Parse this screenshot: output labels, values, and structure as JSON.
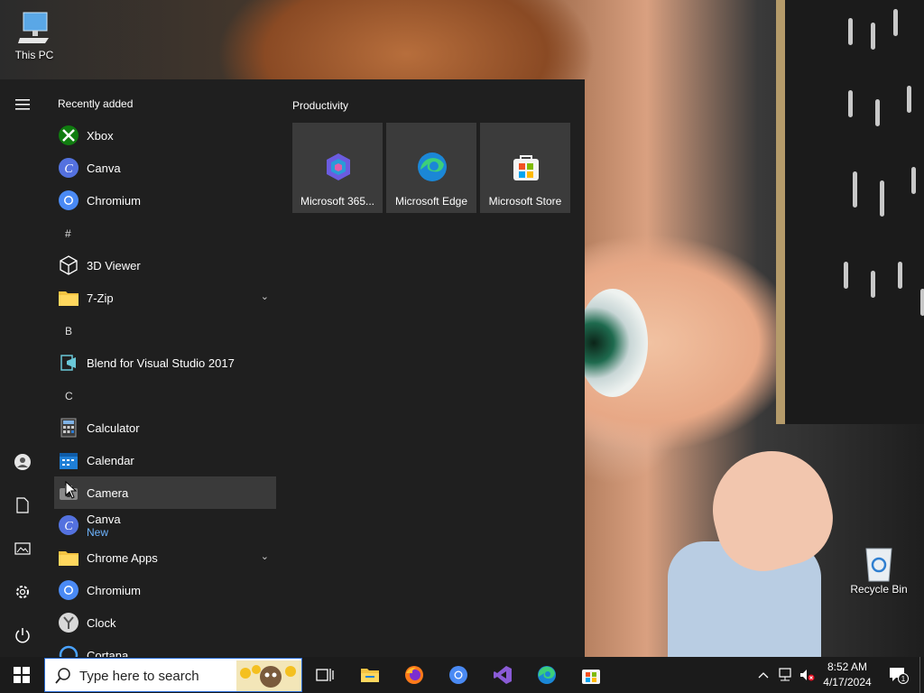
{
  "desktop": {
    "icons": [
      {
        "label": "This PC"
      },
      {
        "label": "Recycle Bin"
      }
    ]
  },
  "start_menu": {
    "rail": {
      "items": [
        "menu-icon",
        "user-icon",
        "documents-icon",
        "pictures-icon",
        "settings-icon",
        "power-icon"
      ]
    },
    "list": {
      "section_title": "Recently added",
      "items": [
        {
          "label": "Xbox",
          "icon": "xbox-icon"
        },
        {
          "label": "Canva",
          "icon": "canva-icon"
        },
        {
          "label": "Chromium",
          "icon": "chromium-icon"
        },
        {
          "letter": "#"
        },
        {
          "label": "3D Viewer",
          "icon": "cube-icon"
        },
        {
          "label": "7-Zip",
          "icon": "folder-icon",
          "expandable": true
        },
        {
          "letter": "B"
        },
        {
          "label": "Blend for Visual Studio 2017",
          "icon": "blend-icon"
        },
        {
          "letter": "C"
        },
        {
          "label": "Calculator",
          "icon": "calculator-icon"
        },
        {
          "label": "Calendar",
          "icon": "calendar-icon"
        },
        {
          "label": "Camera",
          "icon": "camera-icon",
          "highlighted": true
        },
        {
          "label": "Canva",
          "sub": "New",
          "icon": "canva-icon"
        },
        {
          "label": "Chrome Apps",
          "icon": "folder-icon",
          "expandable": true
        },
        {
          "label": "Chromium",
          "icon": "chromium-icon"
        },
        {
          "label": "Clock",
          "icon": "clock-icon"
        },
        {
          "label": "Cortana",
          "icon": "cortana-icon"
        }
      ]
    },
    "tiles": {
      "group_title": "Productivity",
      "items": [
        {
          "label": "Microsoft 365...",
          "icon": "m365-icon"
        },
        {
          "label": "Microsoft Edge",
          "icon": "edge-icon"
        },
        {
          "label": "Microsoft Store",
          "icon": "store-icon"
        }
      ]
    }
  },
  "taskbar": {
    "search_placeholder": "Type here to search",
    "pinned": [
      "task-view-icon",
      "file-explorer-icon",
      "firefox-icon",
      "chromium-icon",
      "visual-studio-icon",
      "edge-icon",
      "store-icon"
    ],
    "clock": {
      "time": "8:52 AM",
      "date": "4/17/2024"
    },
    "notification_count": "1"
  },
  "colors": {
    "start_bg": "#1f1f1f",
    "tile_bg": "#3b3b3b",
    "highlight": "#3a3a3a",
    "accent_new": "#6db4ff",
    "taskbar_bg": "#1b1b1b"
  }
}
